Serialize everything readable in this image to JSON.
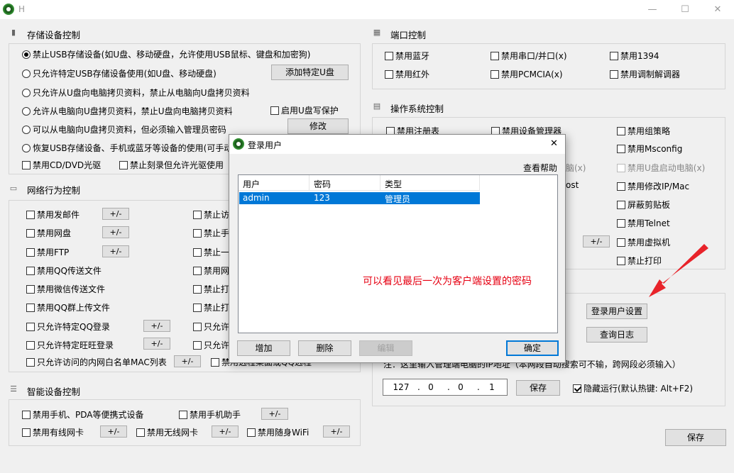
{
  "window": {
    "title": "H",
    "minimize": "—",
    "maximize": "☐",
    "close": "✕"
  },
  "storage": {
    "title": "存储设备控制",
    "opt1": "禁止USB存储设备(如U盘、移动硬盘，允许使用USB鼠标、键盘和加密狗)",
    "opt2": "只允许特定USB存储设备使用(如U盘、移动硬盘)",
    "add_udisk": "添加特定U盘",
    "opt3": "只允许从U盘向电脑拷贝资料，禁止从电脑向U盘拷贝资料",
    "opt4": "允许从电脑向U盘拷贝资料，禁止U盘向电脑拷贝资料",
    "write_protect": "启用U盘写保护",
    "opt5": "可以从电脑向U盘拷贝资料，但必须输入管理员密码",
    "modify": "修改",
    "opt6": "恢复USB存储设备、手机或蓝牙等设备的使用(可手动",
    "cd": "禁用CD/DVD光驱",
    "burn": "禁止刻录但允许光驱使用"
  },
  "network": {
    "title": "网络行为控制",
    "items": [
      "禁用发邮件",
      "禁用网盘",
      "禁用FTP",
      "禁用QQ传送文件",
      "禁用微信传送文件",
      "禁用QQ群上传文件",
      "只允许特定QQ登录",
      "只允许特定旺旺登录",
      "只允许访问的内网白名单MAC列表"
    ],
    "pm": "+/-",
    "right_items": [
      "禁止访",
      "禁止手",
      "禁止一",
      "禁用网",
      "禁止打",
      "禁止打",
      "只允许",
      "只允许",
      "禁用远程桌面或QQ远程"
    ]
  },
  "smart": {
    "title": "智能设备控制",
    "phone": "禁用手机、PDA等便携式设备",
    "assistant": "禁用手机助手",
    "wired": "禁用有线网卡",
    "wireless": "禁用无线网卡",
    "wifi": "禁用随身WiFi",
    "pm": "+/-"
  },
  "port": {
    "title": "端口控制",
    "bluetooth": "禁用蓝牙",
    "serial": "禁用串口/并口(x)",
    "p1394": "禁用1394",
    "infrared": "禁用红外",
    "pcmcia": "禁用PCMCIA(x)",
    "modem": "禁用调制解调器"
  },
  "os": {
    "title": "操作系统控制",
    "regedit": "禁用注册表",
    "devmgr": "禁用设备管理器",
    "gpedit": "禁用组策略",
    "msconfig": "禁用Msconfig",
    "c2": "脑(x)",
    "udisk_boot": "禁用U盘启动电脑(x)",
    "c3": "ost",
    "ipmac": "禁用修改IP/Mac",
    "clipboard": "屏蔽剪贴板",
    "telnet": "禁用Telnet",
    "vm": "禁用虚拟机",
    "print": "禁止打印",
    "pm": "+/-"
  },
  "server": {
    "login_settings": "登录用户设置",
    "query_log": "查询日志",
    "hint": "注：这里输入管理端电脑的IP地址（本网段自动搜索可不输，跨网段必须输入）",
    "ip": [
      "127",
      "0",
      "0",
      "1"
    ],
    "save": "保存",
    "hide_run": "隐藏运行(默认热键: Alt+F2)"
  },
  "save_main": "保存",
  "dialog": {
    "title": "登录用户",
    "help": "查看帮助",
    "columns": [
      "用户",
      "密码",
      "类型"
    ],
    "rows": [
      {
        "user": "admin",
        "password": "123",
        "type": "管理员"
      }
    ],
    "add": "增加",
    "delete": "删除",
    "edit": "编辑",
    "ok": "确定",
    "close": "✕"
  },
  "annotation": "可以看见最后一次为客户端设置的密码",
  "colors": {
    "accent": "#0078d7",
    "annotation": "#e60012"
  }
}
